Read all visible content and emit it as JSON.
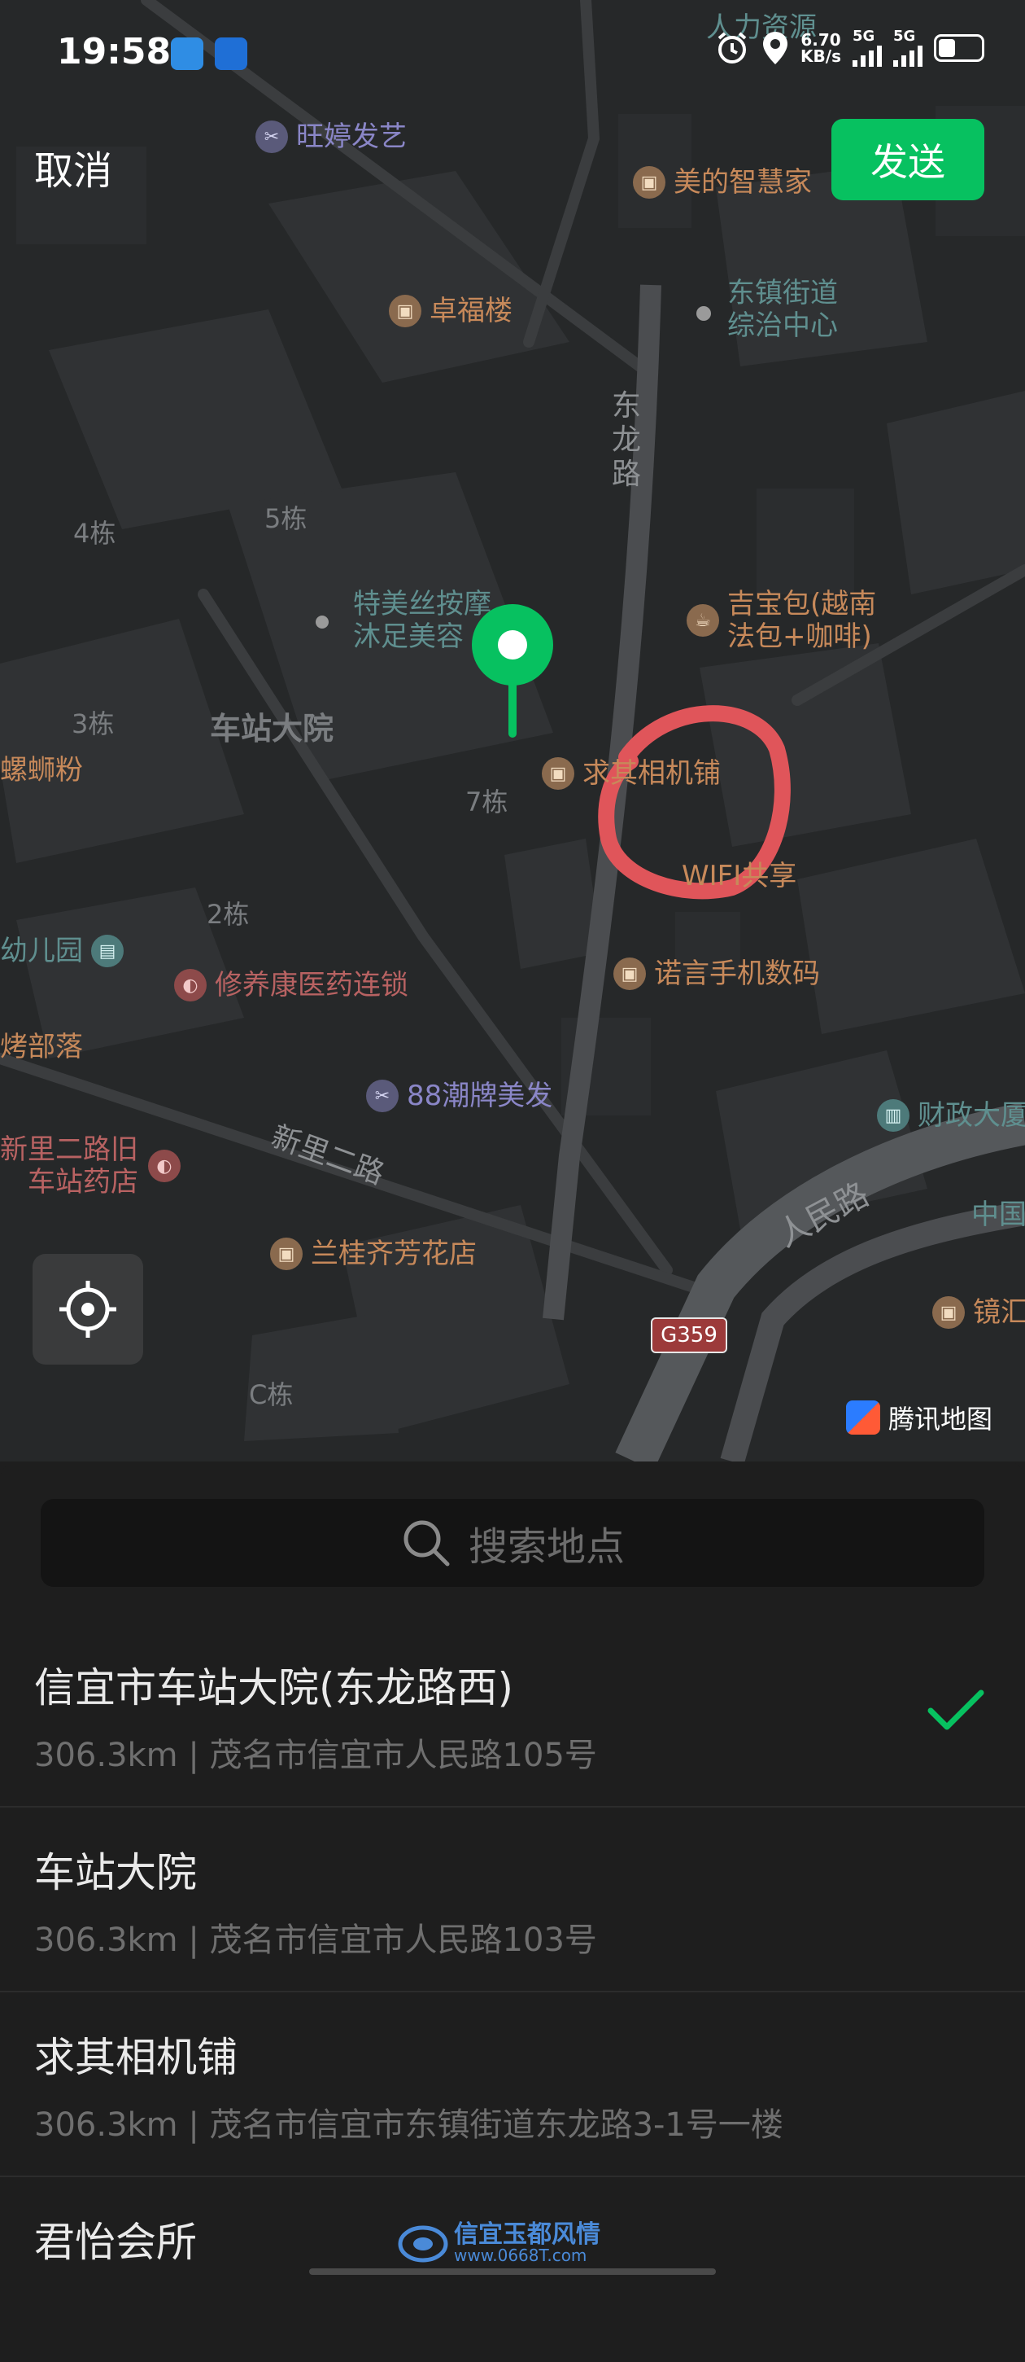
{
  "status_bar": {
    "time": "19:58",
    "net_speed": "6.70",
    "net_unit": "KB/s",
    "sim1": "5G",
    "sim2": "5G",
    "icons": [
      "app-icon",
      "hotspot-icon",
      "alarm-icon",
      "location-icon",
      "signal-icon",
      "battery-icon"
    ]
  },
  "header": {
    "cancel": "取消",
    "send": "发送"
  },
  "map": {
    "pois": {
      "wangting": "旺婷发艺",
      "renli": "人力资源",
      "meide": "美的智慧家",
      "zhuofu": "卓福楼",
      "dongzhen_1": "东镇街道",
      "dongzhen_2": "综治中心",
      "jibao_1": "吉宝包(越南",
      "jibao_2": "法包+咖啡)",
      "temeisi_1": "特美丝按摩",
      "temeisi_2": "沐足美容",
      "qiuqi": "求其相机铺",
      "wifi": "WIFI共享",
      "luosifen": "螺蛳粉",
      "nuoyan": "诺言手机数码",
      "youeryuan": "幼儿园",
      "xiuyang": "修养康医药连锁",
      "kaobuluo": "烤部落",
      "chaopai": "88潮牌美发",
      "caizheng": "财政大厦",
      "xinli_1": "新里二路旧",
      "xinli_2": "车站药店",
      "zhongguo": "中国",
      "langui": "兰桂齐芳花店",
      "jinghui": "镜汇"
    },
    "buildings": {
      "b4": "4栋",
      "b5": "5栋",
      "b3": "3栋",
      "b7": "7栋",
      "b2": "2栋",
      "bc": "C栋"
    },
    "area": "车站大院",
    "roads": {
      "donglong": "东龙路",
      "xinli": "新里二路",
      "renmin": "人民路"
    },
    "shield": "G359",
    "provider": "腾讯地图",
    "accent": "#07c160",
    "annotation_color": "#e0555a"
  },
  "search": {
    "placeholder": "搜索地点"
  },
  "results": [
    {
      "title": "信宜市车站大院(东龙路西)",
      "subtitle": "306.3km | 茂名市信宜市人民路105号",
      "selected": true
    },
    {
      "title": "车站大院",
      "subtitle": "306.3km | 茂名市信宜市人民路103号",
      "selected": false
    },
    {
      "title": "求其相机铺",
      "subtitle": "306.3km | 茂名市信宜市东镇街道东龙路3-1号一楼",
      "selected": false
    },
    {
      "title": "君怡会所",
      "subtitle": "",
      "selected": false
    }
  ],
  "watermark": {
    "title": "信宜玉都风情",
    "url": "www.0668T.com"
  }
}
